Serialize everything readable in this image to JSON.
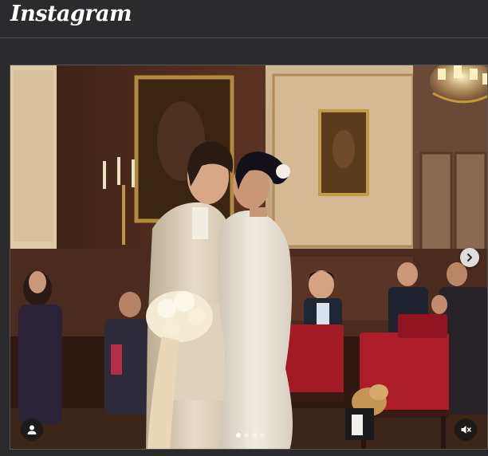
{
  "app": {
    "name": "Instagram"
  },
  "post": {
    "media_type": "photo carousel",
    "carousel_total": 4,
    "carousel_current": 1,
    "next_icon": "chevron-right-icon",
    "tag_icon": "person-icon",
    "mute_icon": "speaker-muted-icon"
  }
}
